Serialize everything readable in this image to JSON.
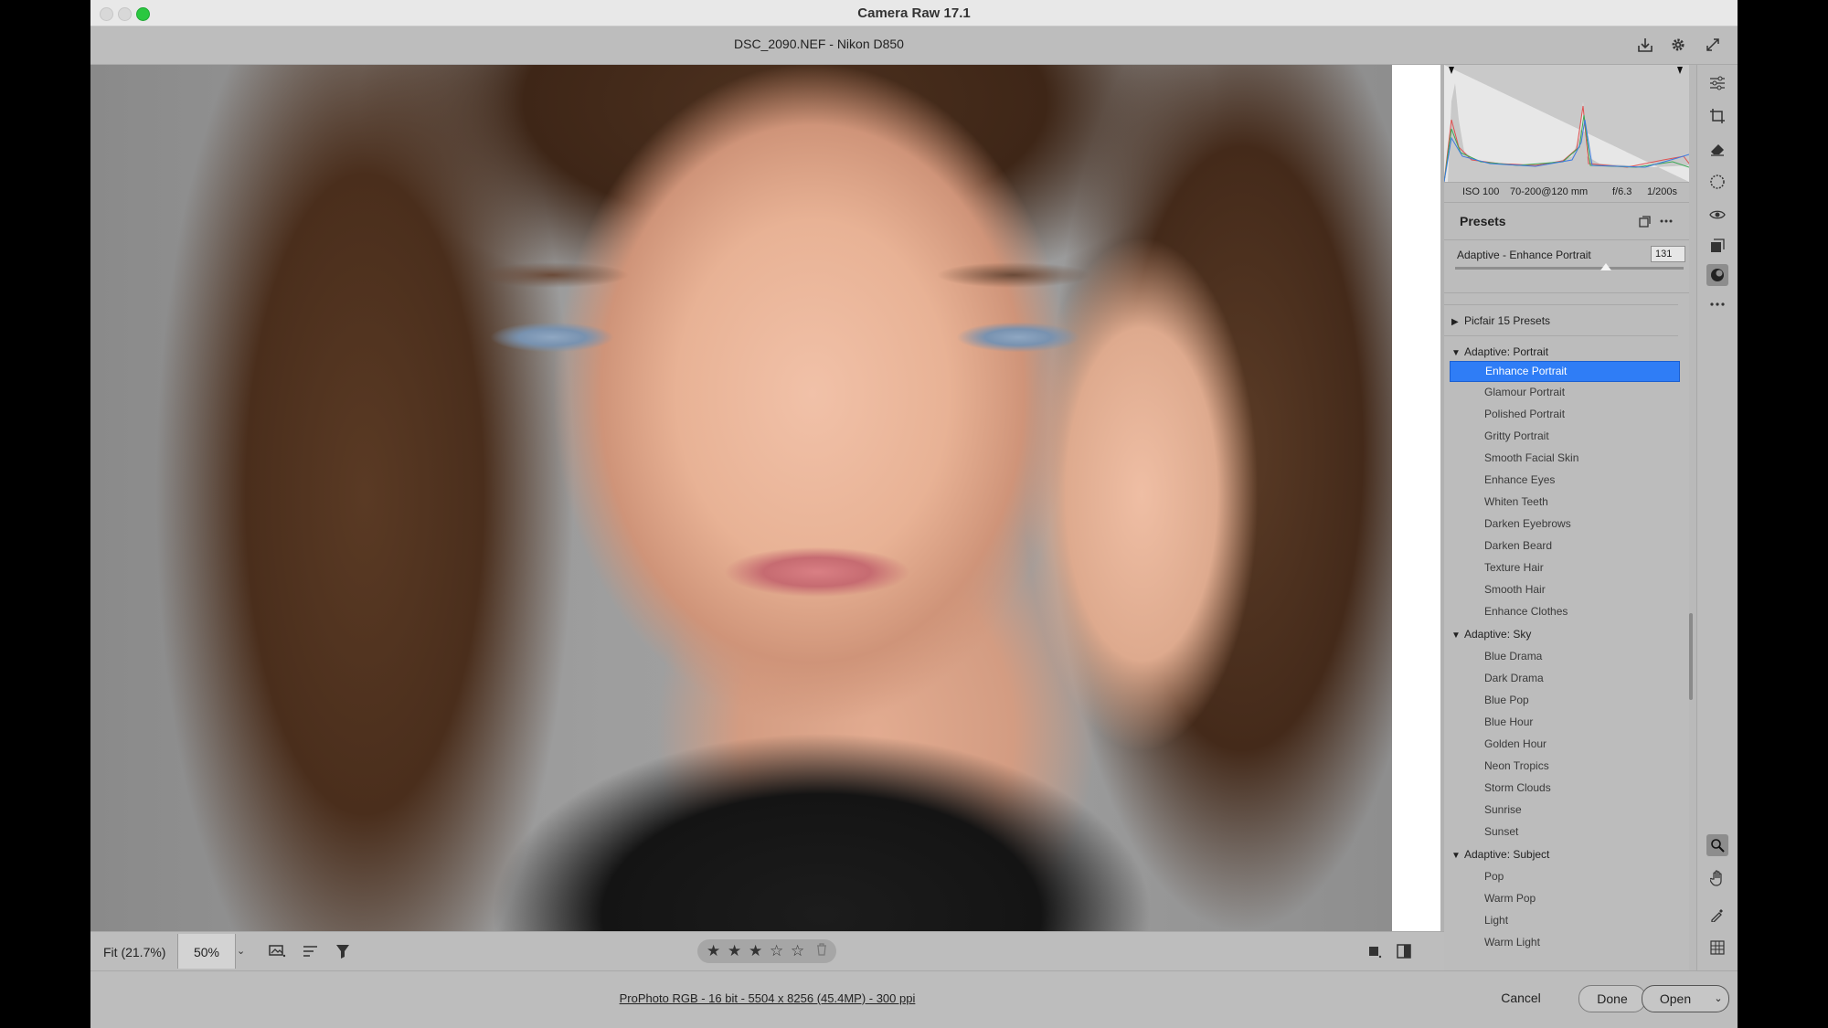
{
  "window": {
    "title": "Camera Raw 17.1"
  },
  "file": {
    "name": "DSC_2090.NEF  -  Nikon D850"
  },
  "exif": {
    "iso": "ISO 100",
    "lens": "70-200@120 mm",
    "aperture": "f/6.3",
    "shutter": "1/200s"
  },
  "presets_panel": {
    "title": "Presets",
    "amount_label": "Adaptive - Enhance Portrait",
    "amount_value": "131",
    "amount_fraction": 0.66,
    "groups": [
      {
        "label": "Picfair 15 Presets",
        "expanded": false
      },
      {
        "label": "Adaptive: Portrait",
        "expanded": true,
        "items": [
          "Enhance Portrait",
          "Glamour Portrait",
          "Polished Portrait",
          "Gritty Portrait",
          "Smooth Facial Skin",
          "Enhance Eyes",
          "Whiten Teeth",
          "Darken Eyebrows",
          "Darken Beard",
          "Texture Hair",
          "Smooth Hair",
          "Enhance Clothes"
        ],
        "selected": "Enhance Portrait"
      },
      {
        "label": "Adaptive: Sky",
        "expanded": true,
        "items": [
          "Blue Drama",
          "Dark Drama",
          "Blue Pop",
          "Blue Hour",
          "Golden Hour",
          "Neon Tropics",
          "Storm Clouds",
          "Sunrise",
          "Sunset"
        ]
      },
      {
        "label": "Adaptive: Subject",
        "expanded": true,
        "items": [
          "Pop",
          "Warm Pop",
          "Light",
          "Warm Light"
        ]
      }
    ]
  },
  "bottombar": {
    "fit_label": "Fit (21.7%)",
    "zoom_value": "50%",
    "rating": 3,
    "max_rating": 5
  },
  "footer": {
    "profile_link": "ProPhoto RGB - 16 bit - 5504 x 8256 (45.4MP) - 300 ppi",
    "cancel": "Cancel",
    "done": "Done",
    "open": "Open"
  },
  "colors": {
    "selection": "#2f7df6",
    "accent_green": "#2ac840"
  },
  "icons": {
    "top": [
      "save-icon",
      "gear-icon",
      "fullscreen-icon"
    ],
    "tools": [
      "edit-sliders-icon",
      "crop-icon",
      "remove-eraser-icon",
      "masking-icon",
      "redeye-icon",
      "snapshots-icon",
      "presets-icon",
      "more-icon",
      "zoom-icon",
      "hand-icon",
      "color-sampler-icon",
      "grid-icon"
    ]
  }
}
